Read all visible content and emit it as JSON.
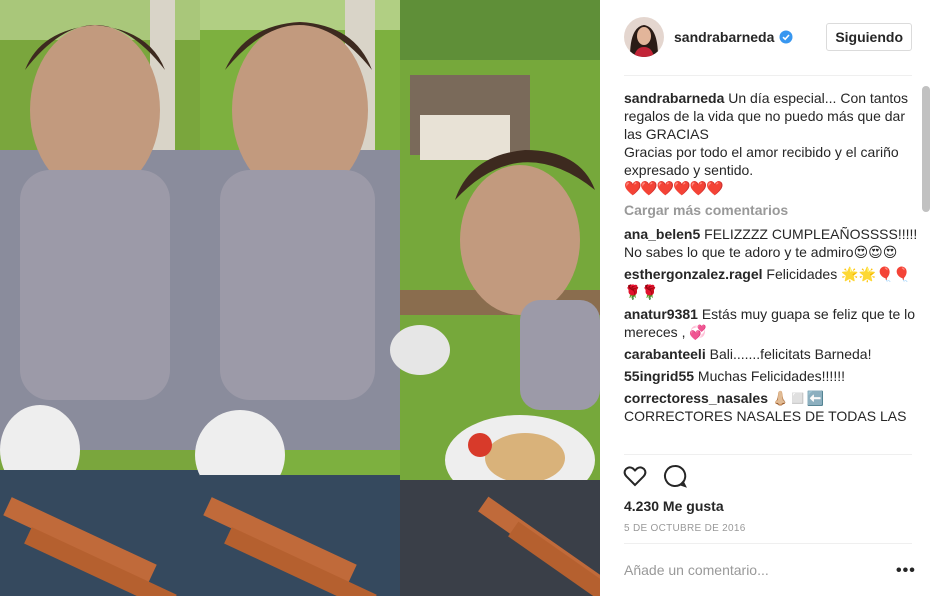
{
  "post": {
    "username": "sandrabarneda",
    "follow_label": "Siguiendo",
    "caption_lines": "Un día especial... Con tantos regalos de la vida que no puedo más que dar las GRACIAS\nGracias por todo el amor recibido y el cariño expresado y sentido.",
    "caption_hearts": "❤️❤️❤️❤️❤️❤️",
    "load_more": "Cargar más comentarios",
    "comments": [
      {
        "user": "ana_belen5",
        "text": "FELIZZZZ CUMPLEAÑOSSSS!!!!! No sabes lo que te adoro y te admiro😍😍😍"
      },
      {
        "user": "esthergonzalez.ragel",
        "text": "Felicidades 🌟🌟🎈🎈🌹🌹"
      },
      {
        "user": "anatur9381",
        "text": "Estás muy guapa se feliz que te lo mereces , 💞"
      },
      {
        "user": "carabanteeli",
        "text": "Bali.......felicitats Barneda!"
      },
      {
        "user": "55ingrid55",
        "text": "Muchas Felicidades!!!!!!"
      },
      {
        "user": "correctoress_nasales",
        "text": "👃🏼◻️⬅️ CORRECTORES NASALES DE TODAS LAS"
      }
    ],
    "likes": "4.230 Me gusta",
    "date": "5 DE OCTUBRE DE 2016",
    "add_comment_placeholder": "Añade un comentario...",
    "more_options": "•••"
  },
  "icons": [
    "heart-icon",
    "comment-icon",
    "verified-badge-icon",
    "more-options-icon"
  ],
  "colors": {
    "verified": "#3897f0",
    "muted": "#999999",
    "divider": "#efefef"
  }
}
